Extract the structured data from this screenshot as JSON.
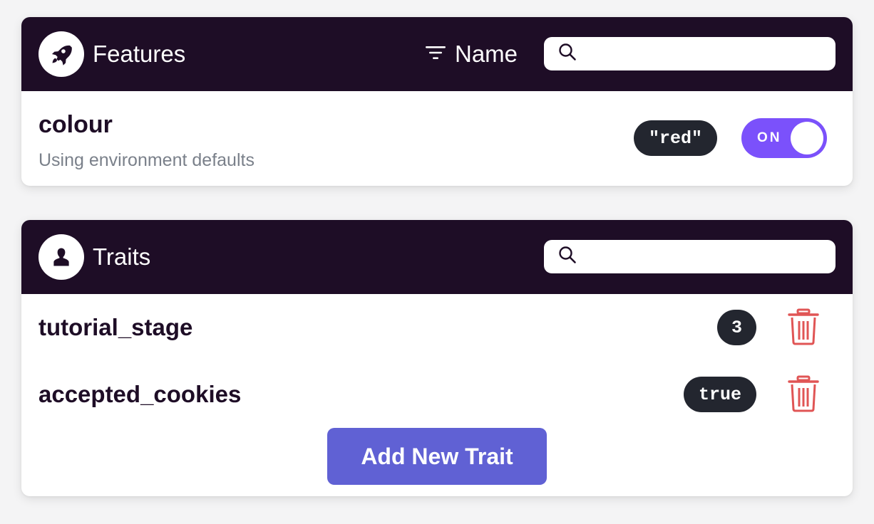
{
  "colors": {
    "header_bg": "#1e0d26",
    "toggle_on": "#7b51fb",
    "pill_bg": "#23262f",
    "delete_red": "#e05555",
    "add_button": "#6061d4"
  },
  "features": {
    "title": "Features",
    "icon": "rocket-icon",
    "sort_icon": "sort-filter-icon",
    "sort_label": "Name",
    "search_placeholder": "",
    "items": [
      {
        "name": "colour",
        "description": "Using environment defaults",
        "value": "\"red\"",
        "toggle_label": "ON",
        "enabled": true
      }
    ]
  },
  "traits": {
    "title": "Traits",
    "icon": "user-icon",
    "search_placeholder": "",
    "items": [
      {
        "name": "tutorial_stage",
        "value": "3",
        "delete_icon": "trash-icon"
      },
      {
        "name": "accepted_cookies",
        "value": "true",
        "delete_icon": "trash-icon"
      }
    ],
    "add_button_label": "Add New Trait"
  }
}
